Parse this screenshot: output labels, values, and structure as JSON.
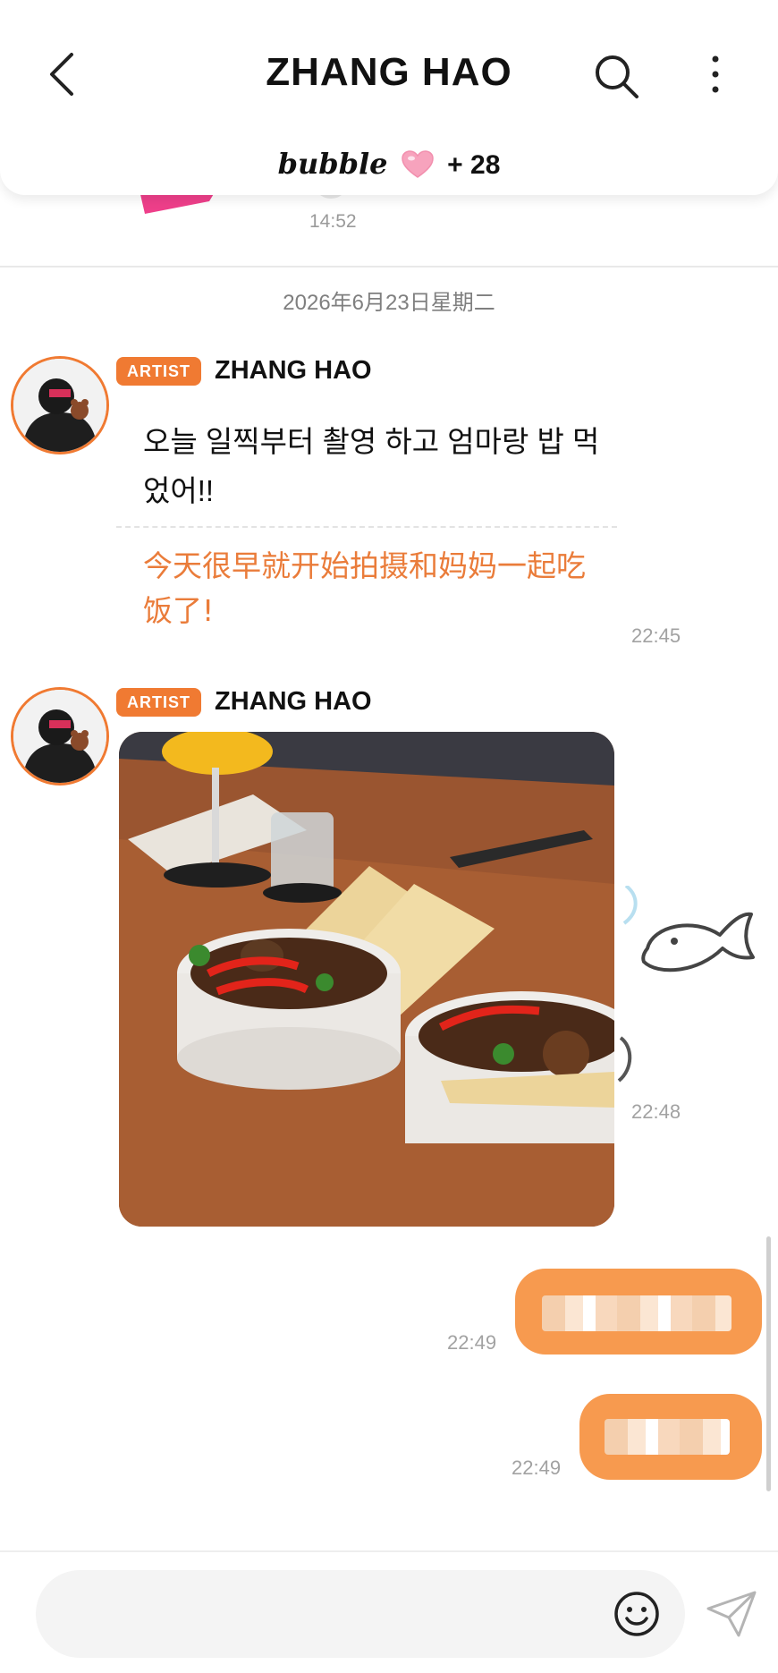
{
  "header": {
    "title": "ZHANG HAO",
    "bubble_word": "bubble",
    "bubble_count": "+ 28"
  },
  "previous_message": {
    "time": "14:52"
  },
  "date_separator": "2026年6月23日星期二",
  "messages": [
    {
      "badge": "ARTIST",
      "sender": "ZHANG HAO",
      "text": "오늘 일찍부터 촬영 하고 엄마랑 밥 먹었어!!",
      "translation": "今天很早就开始拍摄和妈妈一起吃饭了!",
      "time": "22:45"
    },
    {
      "badge": "ARTIST",
      "sender": "ZHANG HAO",
      "image": "food-photo",
      "time": "22:48"
    }
  ],
  "my_messages": [
    {
      "time": "22:49"
    },
    {
      "time": "22:49"
    }
  ],
  "colors": {
    "accent": "#f07a32",
    "my_bubble": "#f79a4f",
    "translation": "#ea7c3a"
  },
  "icons": [
    "back-icon",
    "search-icon",
    "more-icon",
    "heart-icon",
    "emoji-icon",
    "send-icon",
    "fish-sticker"
  ]
}
